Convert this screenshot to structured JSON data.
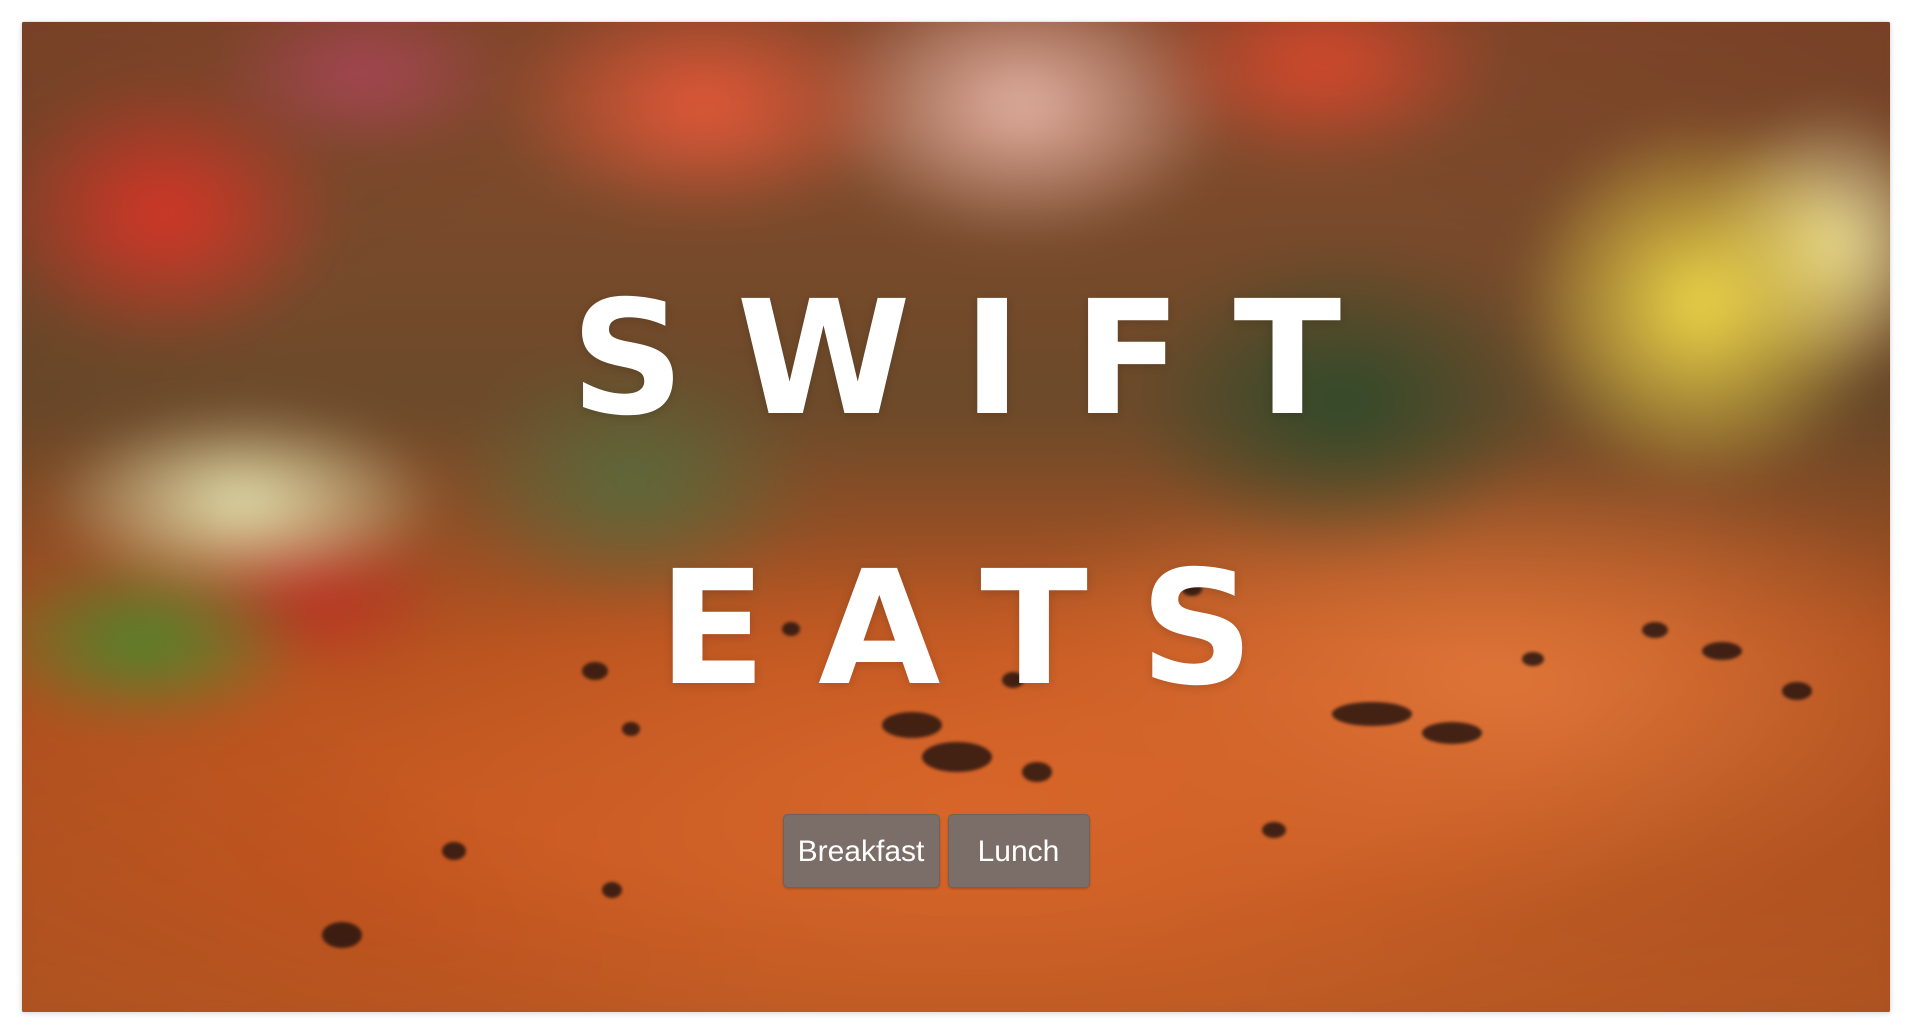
{
  "hero": {
    "title_line1": "SWIFT",
    "title_line2": "EATS",
    "background_icon": "food-photo",
    "buttons": [
      {
        "label": "Breakfast"
      },
      {
        "label": "Lunch"
      }
    ]
  },
  "colors": {
    "button_bg": "#7b6e68",
    "title_text": "#ffffff"
  }
}
